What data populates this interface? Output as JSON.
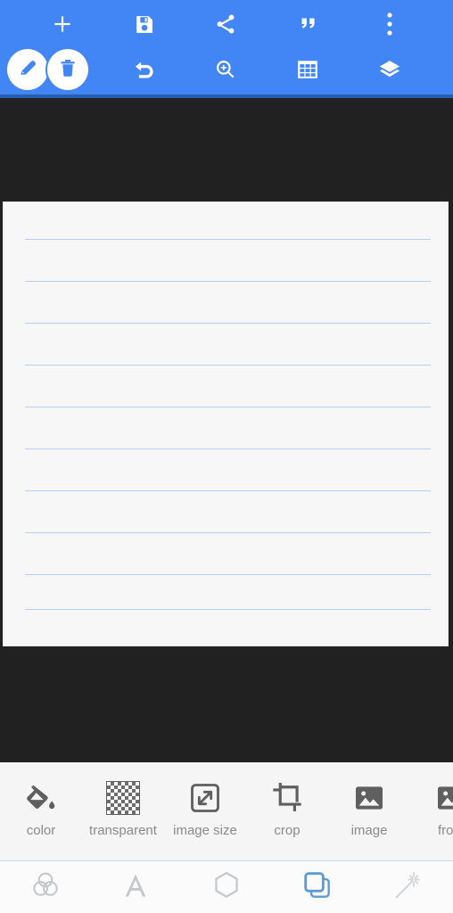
{
  "app": {
    "accent_blue": "#4285F4",
    "accent_blue_dark": "#2a5db0",
    "canvas_bg": "#212121",
    "paper_bg": "#f7f7f7",
    "rule_line_color": "#b9cdf0",
    "toolbar_bg": "#f5f5f5",
    "nav_bg": "#fbfbfb",
    "nav_selected_color": "#5b9bd5",
    "nav_idle_color": "#c3c8cc",
    "label_color": "#8a8a8a",
    "icon_color": "#5f5f5f"
  },
  "topbar": {
    "row1": [
      {
        "name": "add-icon",
        "label": "add"
      },
      {
        "name": "save-icon",
        "label": "save"
      },
      {
        "name": "share-icon",
        "label": "share"
      },
      {
        "name": "quote-icon",
        "label": "quote"
      },
      {
        "name": "overflow-menu-icon",
        "label": "more options"
      }
    ],
    "row2": [
      {
        "name": "pen-icon",
        "label": "draw"
      },
      {
        "name": "trash-icon",
        "label": "delete"
      },
      {
        "name": "undo-icon",
        "label": "undo"
      },
      {
        "name": "zoom-in-icon",
        "label": "zoom"
      },
      {
        "name": "grid-icon",
        "label": "grid"
      },
      {
        "name": "layers-icon",
        "label": "layers"
      }
    ]
  },
  "canvas": {
    "paper_label": "ruled note paper",
    "rule_line_count": 10,
    "rule_line_positions": [
      41,
      88,
      135,
      182,
      229,
      276,
      323,
      370,
      417,
      456
    ]
  },
  "image_toolbar": {
    "items": [
      {
        "label": "color",
        "icon": "paint-bucket-icon"
      },
      {
        "label": "transparent",
        "icon": "checkerboard-icon"
      },
      {
        "label": "image size",
        "icon": "resize-icon"
      },
      {
        "label": "crop",
        "icon": "crop-icon"
      },
      {
        "label": "image",
        "icon": "picture-icon"
      },
      {
        "label": "from",
        "icon": "picture-from-icon"
      }
    ]
  },
  "bottom_nav": {
    "items": [
      {
        "label": "color",
        "icon": "venn-circles-icon",
        "selected": false
      },
      {
        "label": "text",
        "icon": "text-a-icon",
        "selected": false
      },
      {
        "label": "shape",
        "icon": "hexagon-icon",
        "selected": false
      },
      {
        "label": "layers",
        "icon": "layers-copy-icon",
        "selected": true
      },
      {
        "label": "effects",
        "icon": "magic-wand-icon",
        "selected": false
      }
    ]
  }
}
